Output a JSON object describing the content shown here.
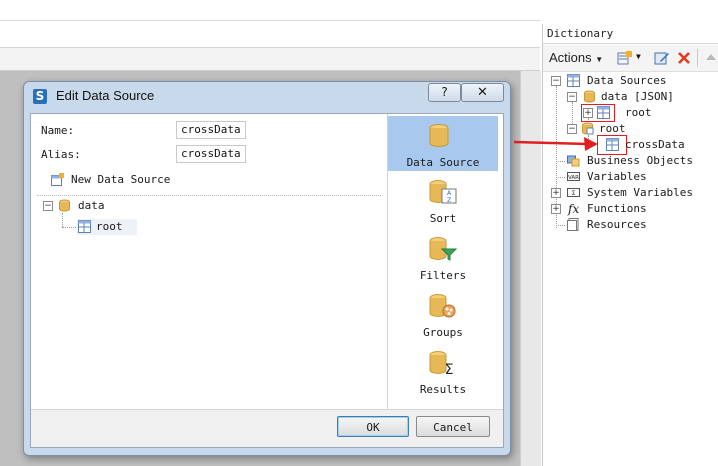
{
  "dictionary": {
    "title": "Dictionary",
    "toolbar": {
      "actions_label": "Actions",
      "icons": [
        "new-item-icon",
        "edit-icon",
        "delete-icon",
        "move-up-icon"
      ]
    },
    "tree": {
      "data_sources": "Data Sources",
      "data_json": "data [JSON]",
      "root_table": "root",
      "root_category": "root",
      "cross_data": "crossData",
      "business_objects": "Business Objects",
      "variables": "Variables",
      "system_variables": "System Variables",
      "functions": "Functions",
      "resources": "Resources"
    }
  },
  "dialog": {
    "title": "Edit Data Source",
    "help_label": "?",
    "close_label": "✕",
    "name_label": "Name:",
    "name_value": "crossData",
    "alias_label": "Alias:",
    "alias_value": "crossData",
    "new_data_source_label": "New Data Source",
    "tree_data": "data",
    "tree_root": "root",
    "side_items": [
      "Data Source",
      "Sort",
      "Filters",
      "Groups",
      "Results"
    ],
    "ok_label": "OK",
    "cancel_label": "Cancel"
  },
  "colors": {
    "accent_selected": "#a9c8ee",
    "annotation_red": "#e02020",
    "cylinder": "#e7b857"
  }
}
